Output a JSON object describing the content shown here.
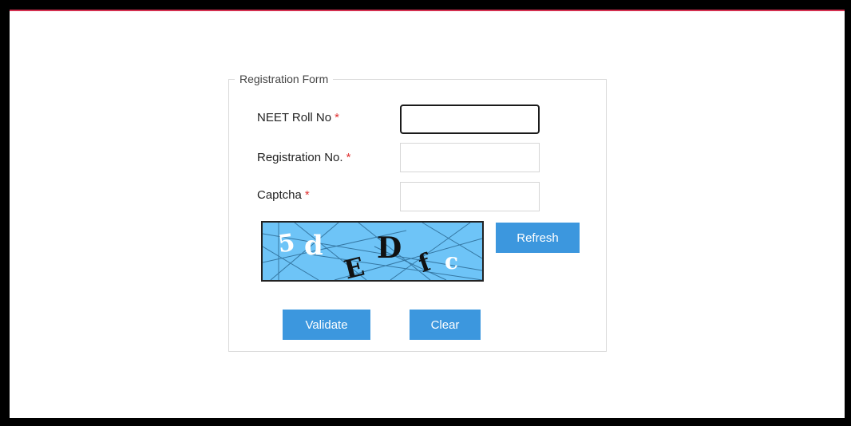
{
  "form": {
    "legend": "Registration Form",
    "fields": [
      {
        "label": "NEET Roll No",
        "required": "*",
        "value": ""
      },
      {
        "label": "Registration No.",
        "required": "*",
        "value": ""
      },
      {
        "label": "Captcha",
        "required": "*",
        "value": ""
      }
    ],
    "captcha": {
      "characters": [
        "5",
        "d",
        "E",
        "D",
        "f",
        "c"
      ]
    },
    "buttons": {
      "refresh": "Refresh",
      "validate": "Validate",
      "clear": "Clear"
    }
  },
  "colors": {
    "accent_button": "#3c97de",
    "required_marker": "#e03030",
    "captcha_background": "#6ec4f7"
  }
}
